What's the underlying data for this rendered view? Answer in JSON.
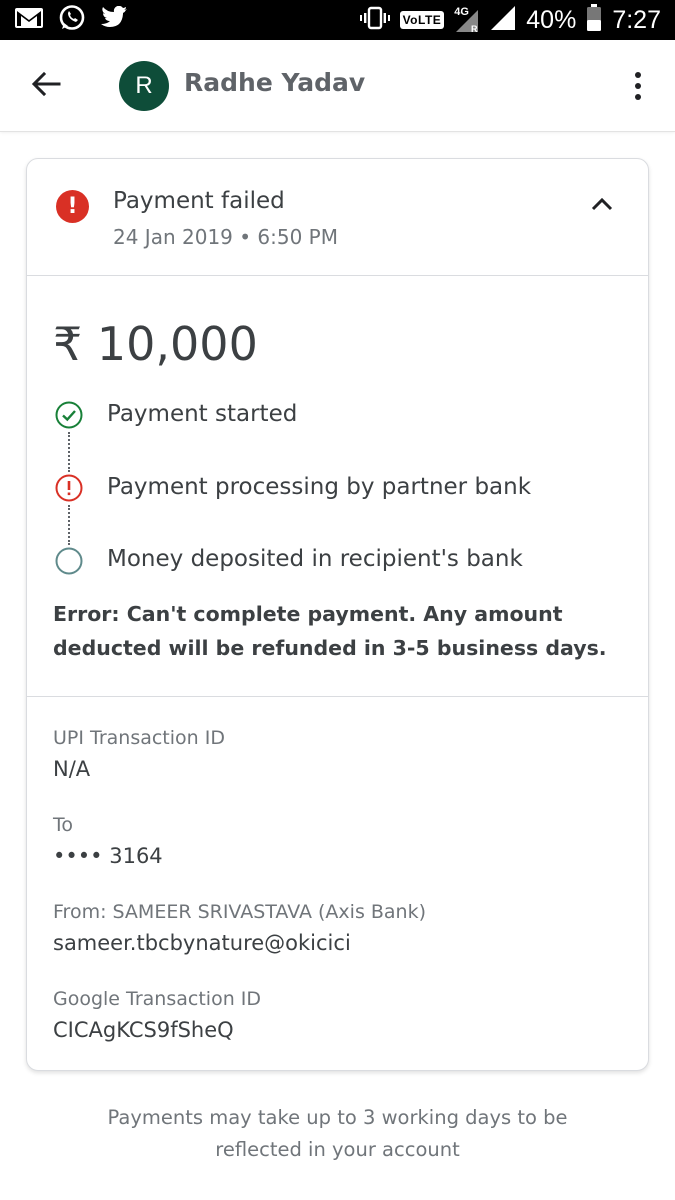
{
  "status_bar": {
    "icons_left": [
      "gmail-icon",
      "whatsapp-icon",
      "twitter-icon"
    ],
    "volte": "VoLTE",
    "network": "4G",
    "network_sub": "R",
    "battery": "40%",
    "time": "7:27"
  },
  "header": {
    "avatar_letter": "R",
    "contact_name": "Radhe Yadav",
    "avatar_color": "#0e4d39"
  },
  "card": {
    "status_title": "Payment failed",
    "status_date": "24 Jan 2019 • 6:50 PM",
    "amount": "₹ 10,000",
    "steps": [
      {
        "label": "Payment started",
        "state": "done",
        "icon": "check-circle-icon"
      },
      {
        "label": "Payment processing by partner bank",
        "state": "error",
        "icon": "error-circle-icon"
      },
      {
        "label": "Money deposited in recipient's bank",
        "state": "pending",
        "icon": "empty-circle-icon"
      }
    ],
    "error_message": "Error: Can't complete payment. Any amount deducted will be refunded in 3-5 business days.",
    "details": [
      {
        "label": "UPI Transaction ID",
        "value": "N/A"
      },
      {
        "label": "To",
        "value": "•••• 3164"
      },
      {
        "label": "From: SAMEER SRIVASTAVA (Axis Bank)",
        "value": "sameer.tbcbynature@okicici"
      },
      {
        "label": "Google Transaction ID",
        "value": "CICAgKCS9fSheQ"
      }
    ]
  },
  "footer": {
    "line1": "Payments may take up to 3 working days to be",
    "line2": "reflected in your account"
  },
  "colors": {
    "error": "#d93025",
    "success": "#188038",
    "pending": "#5f8a8b"
  }
}
